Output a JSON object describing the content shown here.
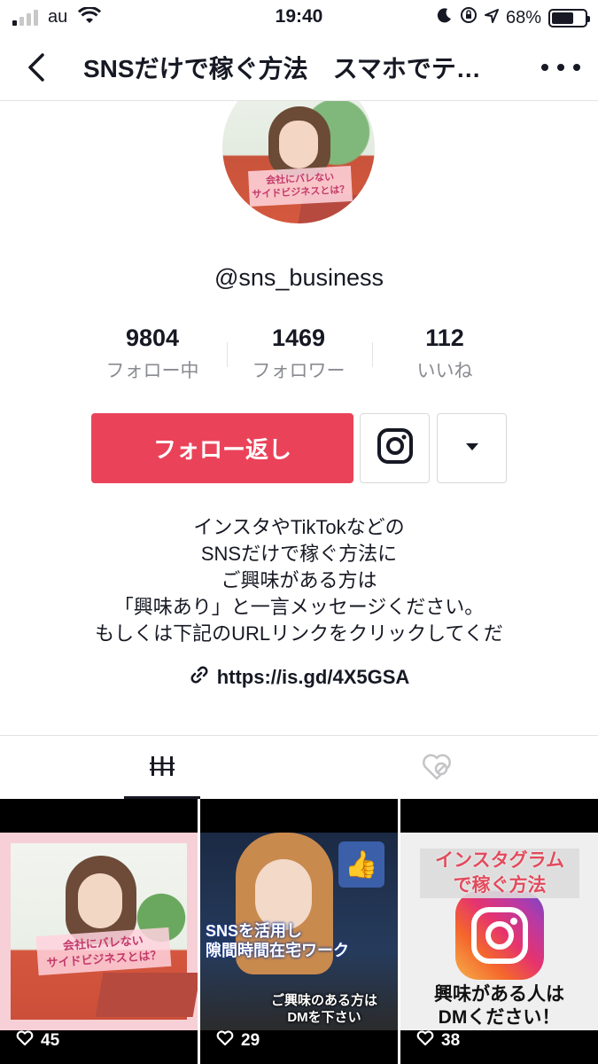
{
  "status_bar": {
    "carrier": "au",
    "time": "19:40",
    "battery": "68%",
    "battery_level": 0.68
  },
  "nav": {
    "title": "SNSだけで稼ぐ方法　スマホでテ…"
  },
  "avatar": {
    "badge_line1": "会社にバレない",
    "badge_line2": "サイドビジネスとは？"
  },
  "profile": {
    "username": "@sns_business",
    "stats": [
      {
        "value": "9804",
        "label": "フォロー中"
      },
      {
        "value": "1469",
        "label": "フォロワー"
      },
      {
        "value": "112",
        "label": "いいね"
      }
    ],
    "follow_button": "フォロー返し",
    "bio_lines": [
      "インスタやTikTokなどの",
      "SNSだけで稼ぐ方法に",
      "ご興味がある方は",
      "「興味あり」と一言メッセージください。",
      "もしくは下記のURLリンクをクリックしてくだ"
    ],
    "link": "https://is.gd/4X5GSA"
  },
  "tabs": {
    "videos_icon": "grid-icon",
    "liked_icon": "heart-hidden-icon"
  },
  "videos": [
    {
      "likes": "45",
      "text_line1": "会社にバレない",
      "text_line2": "サイドビジネスとは？"
    },
    {
      "likes": "29",
      "text_line1": "SNSを活用し",
      "text_line2": "隙間時間在宅ワーク",
      "text_line3": "ご興味のある方は",
      "text_line4": "DMを下さい"
    },
    {
      "likes": "38",
      "text_line1": "インスタグラム",
      "text_line2": "で稼ぐ方法",
      "text_line3": "興味がある人は",
      "text_line4": "DMください！"
    }
  ],
  "colors": {
    "accent": "#ea4359",
    "text": "#161823",
    "muted": "#8a8b91"
  }
}
